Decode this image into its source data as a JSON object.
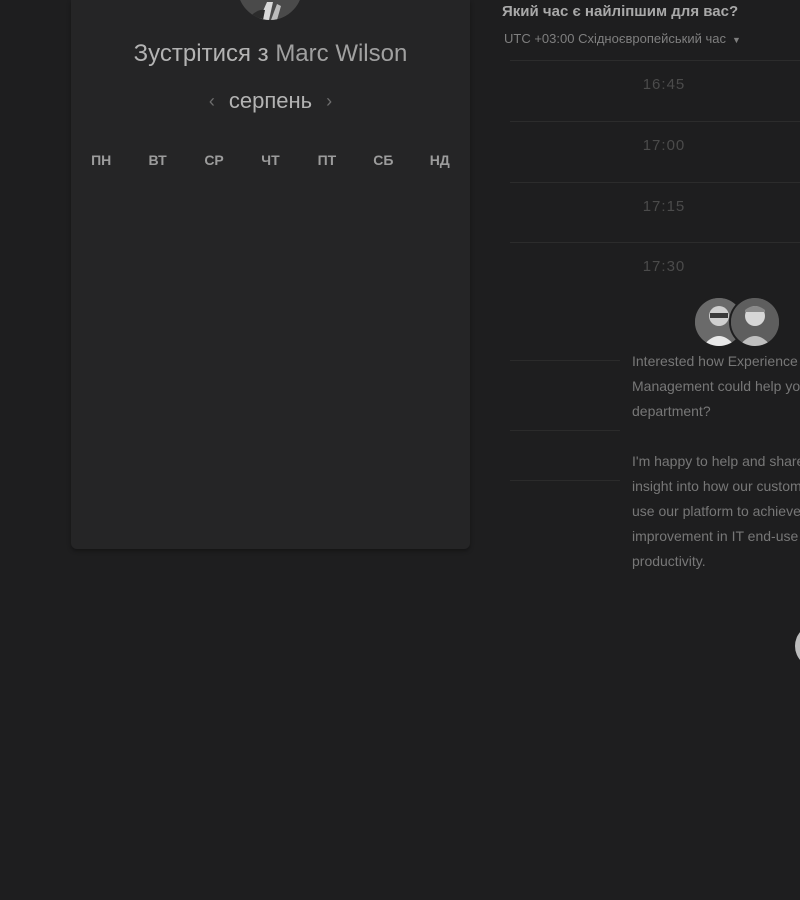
{
  "booking": {
    "title_prefix": "Зустрітися з",
    "host_name": "Marc Wilson",
    "month": "серпень",
    "prev_month_icon": "chevron-left-icon",
    "next_month_icon": "chevron-right-icon",
    "weekdays": [
      "ПН",
      "ВТ",
      "СР",
      "ЧТ",
      "ПТ",
      "СБ",
      "НД"
    ]
  },
  "times": {
    "question": "Який час є найліпшим для вас?",
    "timezone": "UTC +03:00 Східноєвропейський час",
    "slots": [
      "16:45",
      "17:00",
      "17:15",
      "17:30"
    ]
  },
  "chat": {
    "message_p1": [
      "Interested how Experience",
      "Management could help yo",
      "department?"
    ],
    "message_p2": [
      "I'm happy to help and share",
      "insight into how our custom",
      "use our platform to achieve",
      "improvement in IT end-use",
      "productivity."
    ]
  },
  "colors": {
    "background": "#1e1e1f",
    "panel": "#252526"
  }
}
